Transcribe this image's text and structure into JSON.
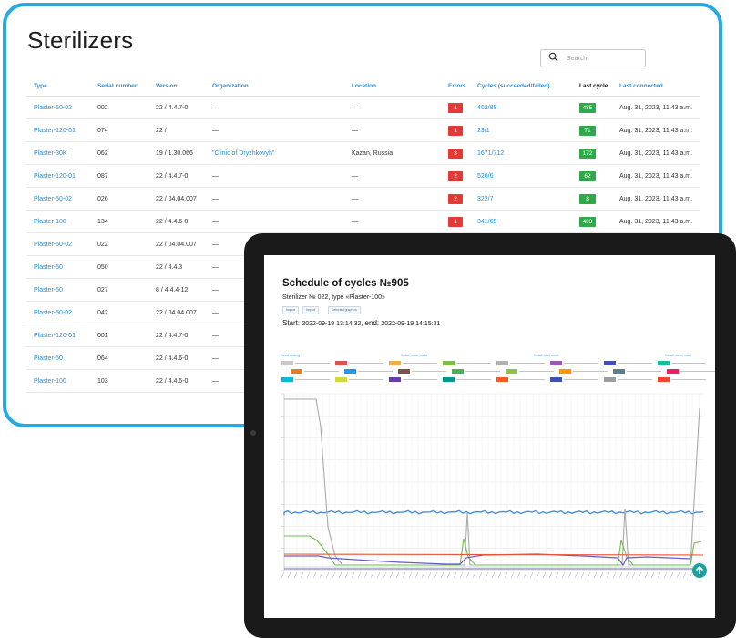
{
  "app": {
    "title": "Sterilizers"
  },
  "search": {
    "placeholder": "Search",
    "icon": "search-icon"
  },
  "table": {
    "headers": [
      "Type",
      "Serial number",
      "Version",
      "Organization",
      "Location",
      "Errors",
      "Cycles (succeeded/failed)",
      "Last cycle",
      "Last connected"
    ],
    "rows": [
      [
        "Plaster-50-02",
        "002",
        "22 / 4.4.7-0",
        "—",
        "—",
        "1",
        "402/88",
        "485",
        "Aug. 31, 2023, 11:43 a.m."
      ],
      [
        "Plaster-120-01",
        "074",
        "22 /",
        "—",
        "—",
        "1",
        "29/1",
        "71",
        "Aug. 31, 2023, 11:43 a.m."
      ],
      [
        "Plaster-30K",
        "062",
        "19 / 1.30.066",
        "\"Clinic of Dryzhkovyh\"",
        "Kazan, Russia",
        "3",
        "1671/712",
        "172",
        "Aug. 31, 2023, 11:43 a.m."
      ],
      [
        "Plaster-120-01",
        "087",
        "22 / 4.4.7-0",
        "—",
        "—",
        "2",
        "526/6",
        "62",
        "Aug. 31, 2023, 11:43 a.m."
      ],
      [
        "Plaster-50-02",
        "026",
        "22 / 04.04.007",
        "—",
        "—",
        "2",
        "322/7",
        "8",
        "Aug. 31, 2023, 11:43 a.m."
      ],
      [
        "Plaster-100",
        "134",
        "22 / 4.4.6-0",
        "—",
        "—",
        "1",
        "341/65",
        "403",
        "Aug. 31, 2023, 11:43 a.m."
      ],
      [
        "Plaster-50-02",
        "022",
        "22 / 04.04.007",
        "—",
        "",
        "",
        "",
        "",
        ""
      ],
      [
        "Plaster-50",
        "050",
        "22 / 4.4.3",
        "—",
        "",
        "",
        "",
        "",
        ""
      ],
      [
        "Plaster-50",
        "027",
        "8 / 4.4.4-12",
        "—",
        "",
        "",
        "",
        "",
        ""
      ],
      [
        "Plaster-50-02",
        "042",
        "22 / 04.04.007",
        "—",
        "",
        "",
        "",
        "",
        ""
      ],
      [
        "Plaster-120-01",
        "001",
        "22 / 4.4.7-0",
        "—",
        "",
        "",
        "",
        "",
        ""
      ],
      [
        "Plaster-50",
        "064",
        "22 / 4.4.6-0",
        "—",
        "",
        "",
        "",
        "",
        ""
      ],
      [
        "Plaster-100",
        "103",
        "22 / 4.4.6-0",
        "—",
        "",
        "",
        "",
        "",
        ""
      ]
    ]
  },
  "tablet": {
    "title": "Schedule of cycles  №905",
    "subtitle": "Sterilizer № 022, type «Plaster-100»",
    "buttons": [
      "Import",
      "Import",
      "Selected graphics"
    ],
    "start_label": "Start:",
    "start_value": "2022-09-19 13:14:32,",
    "end_label": "end:",
    "end_value": "2022-09-19 14:15:21",
    "mode_links": [
      "Reset scaling",
      "Switch scale mode",
      "Switch start mode",
      "Switch zoom mode"
    ],
    "legend_colors": [
      "#c9c9c9",
      "#d9534f",
      "#f0ad4e",
      "#7bc043",
      "#b0b0b0",
      "#9b59b6",
      "#3f51b5",
      "#1abc9c",
      "#e67e22",
      "#2196f3",
      "#795548",
      "#4caf50",
      "#8bc34a",
      "#ff9800",
      "#607d8b",
      "#e91e63",
      "#00bcd4",
      "#cddc39",
      "#673ab7",
      "#009688",
      "#ff5722",
      "#3f51b5",
      "#9e9e9e",
      "#f44336"
    ],
    "colors": {
      "blue": "#4a90d9",
      "gray": "#aaaaaa",
      "green": "#6cbf4a",
      "purple": "#6a5acd",
      "red": "#e8543a",
      "teal": "#16a2a0"
    }
  }
}
